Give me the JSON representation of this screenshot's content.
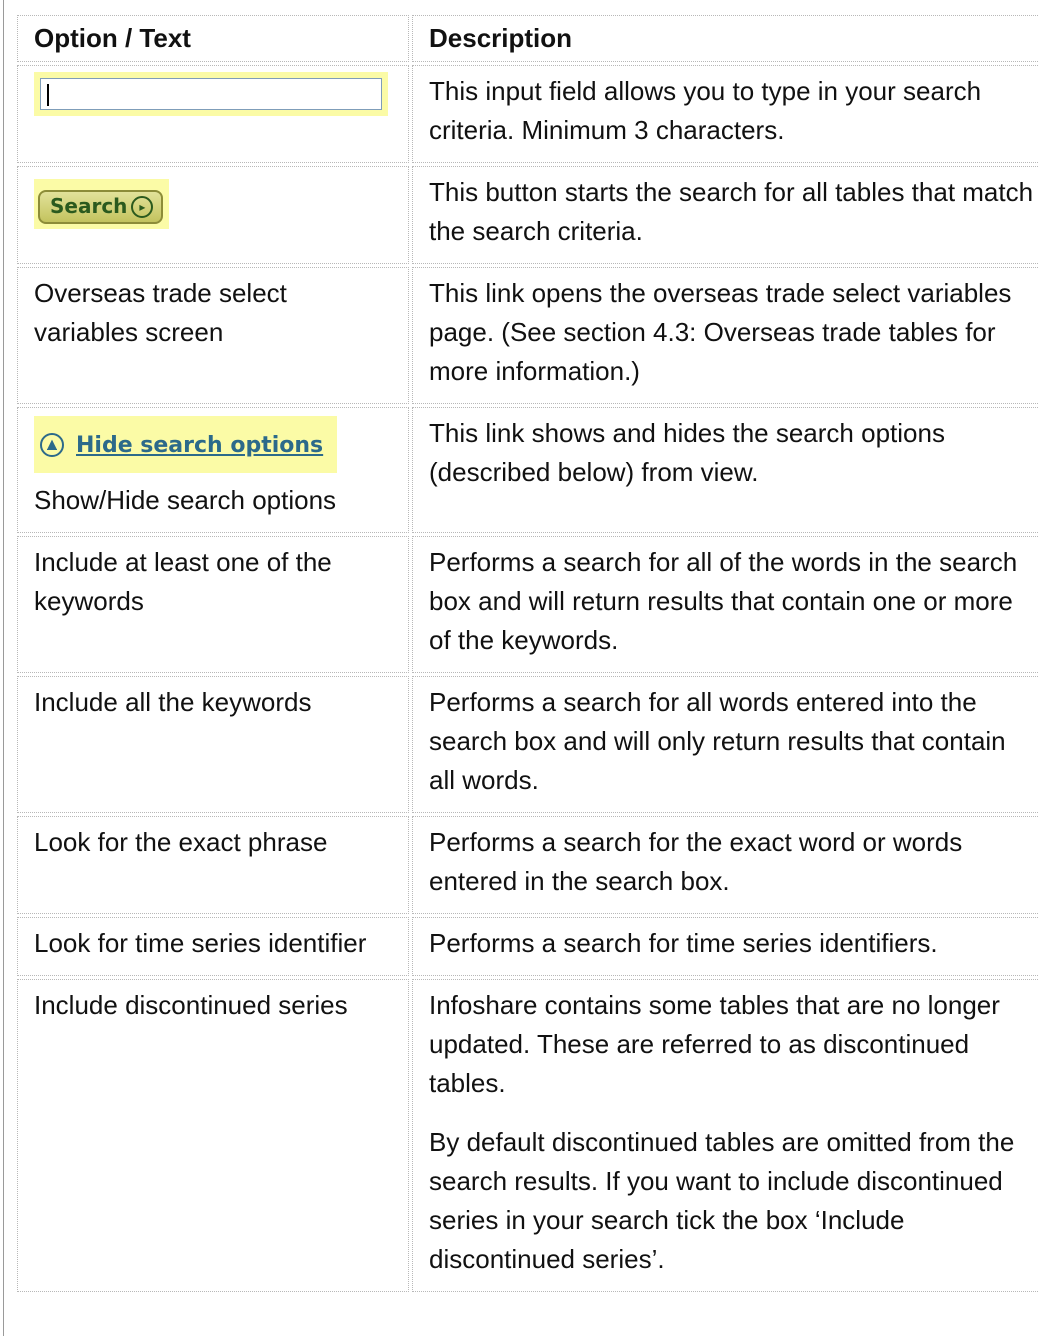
{
  "header": {
    "col1": "Option / Text",
    "col2": "Description"
  },
  "samples": {
    "search_button_label": "Search",
    "hide_link_label": "Hide search options"
  },
  "rows": [
    {
      "option": "",
      "description": "This input field allows you to type in your search criteria. Minimum 3 characters."
    },
    {
      "option": "",
      "description": "This button starts the search for all tables that match the search criteria."
    },
    {
      "option": "Overseas trade select variables screen",
      "description": "This link opens the overseas trade select variables page. (See section 4.3: Overseas trade tables for more information.)"
    },
    {
      "option": "Show/Hide search options",
      "description": "This link shows and hides the search options (described below) from view."
    },
    {
      "option": "Include at least one of the keywords",
      "description": "Performs a search for all of the words in the search box and will return results that contain one or more of the keywords."
    },
    {
      "option": "Include all the keywords",
      "description": "Performs a search for all words entered into the search box and will only return results that contain all words."
    },
    {
      "option": "Look for the exact phrase",
      "description": "Performs a search for the exact word or words entered in the search box."
    },
    {
      "option": "Look for time series identifier",
      "description": "Performs a search for time series identifiers."
    },
    {
      "option": "Include discontinued series",
      "description": "Infoshare contains some tables that are no longer updated. These are referred to as discontinued tables.",
      "description_2": "By default discontinued tables are omitted from the search results. If you want to include discontinued series in your search tick the box ‘Include discontinued series’."
    }
  ]
}
